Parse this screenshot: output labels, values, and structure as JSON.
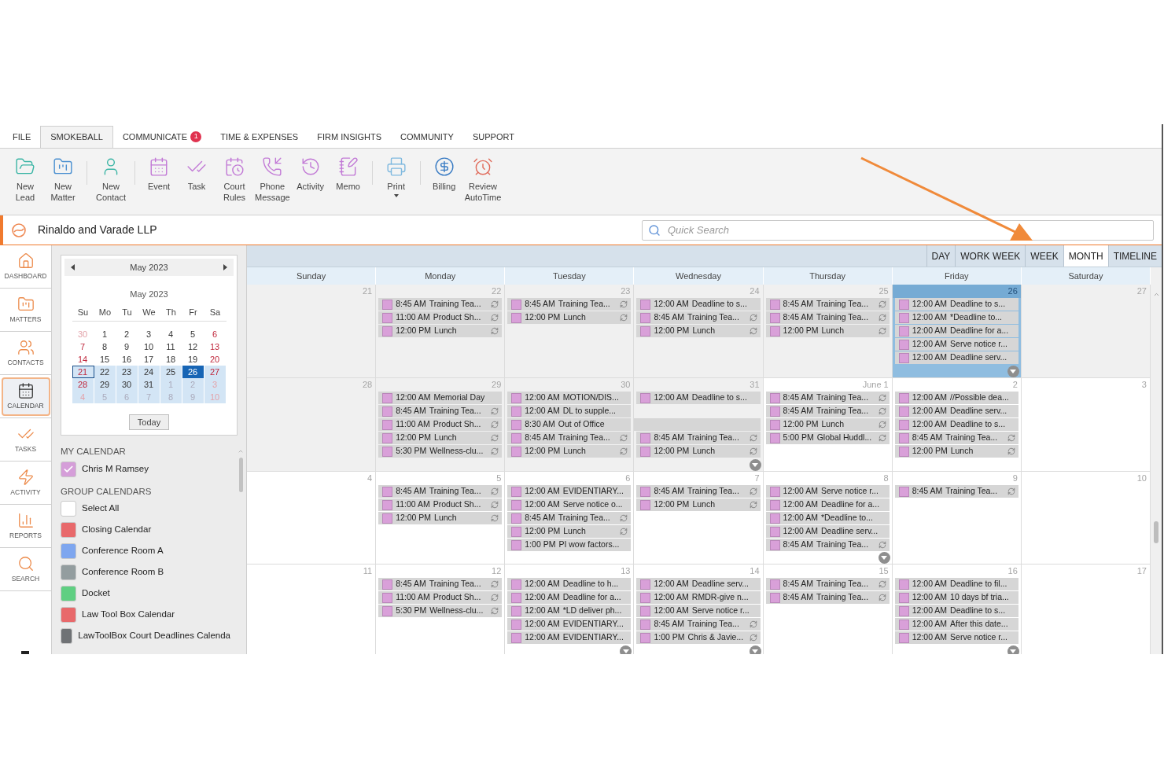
{
  "menu_tabs": [
    {
      "label": "FILE",
      "selected": false
    },
    {
      "label": "SMOKEBALL",
      "selected": true
    },
    {
      "label": "COMMUNICATE",
      "selected": false,
      "badge": "1"
    },
    {
      "label": "TIME & EXPENSES",
      "selected": false
    },
    {
      "label": "FIRM INSIGHTS",
      "selected": false
    },
    {
      "label": "COMMUNITY",
      "selected": false
    },
    {
      "label": "SUPPORT",
      "selected": false
    }
  ],
  "ribbon_groups": [
    [
      {
        "label": "New\nLead"
      },
      {
        "label": "New\nMatter"
      }
    ],
    [
      {
        "label": "New\nContact"
      }
    ],
    [
      {
        "label": "Event"
      },
      {
        "label": "Task"
      },
      {
        "label": "Court\nRules"
      },
      {
        "label": "Phone\nMessage"
      },
      {
        "label": "Activity"
      },
      {
        "label": "Memo"
      }
    ],
    [
      {
        "label": "Print",
        "dropdown": true
      }
    ],
    [
      {
        "label": "Billing"
      },
      {
        "label": "Review\nAutoTime"
      }
    ]
  ],
  "firm": {
    "name": "Rinaldo and Varade LLP"
  },
  "search": {
    "placeholder": "Quick Search"
  },
  "views": [
    {
      "label": "DAY",
      "selected": false
    },
    {
      "label": "WORK WEEK",
      "selected": false
    },
    {
      "label": "WEEK",
      "selected": false
    },
    {
      "label": "MONTH",
      "selected": true
    },
    {
      "label": "TIMELINE",
      "selected": false
    }
  ],
  "nav": [
    {
      "label": "DASHBOARD",
      "selected": false
    },
    {
      "label": "MATTERS",
      "selected": false
    },
    {
      "label": "CONTACTS",
      "selected": false
    },
    {
      "label": "CALENDAR",
      "selected": true
    },
    {
      "label": "TASKS",
      "selected": false
    },
    {
      "label": "ACTIVITY",
      "selected": false
    },
    {
      "label": "REPORTS",
      "selected": false
    },
    {
      "label": "SEARCH",
      "selected": false
    }
  ],
  "mini_calendar": {
    "header": "May 2023",
    "title": "May 2023",
    "weekdays": [
      "Su",
      "Mo",
      "Tu",
      "We",
      "Th",
      "Fr",
      "Sa"
    ],
    "today_button": "Today",
    "days": [
      {
        "label": "30",
        "other_month": true,
        "weekend": true,
        "in_range": false,
        "today": false,
        "selected": false
      },
      {
        "label": "1",
        "other_month": false,
        "weekend": false,
        "in_range": false,
        "today": false,
        "selected": false
      },
      {
        "label": "2",
        "other_month": false,
        "weekend": false,
        "in_range": false,
        "today": false,
        "selected": false
      },
      {
        "label": "3",
        "other_month": false,
        "weekend": false,
        "in_range": false,
        "today": false,
        "selected": false
      },
      {
        "label": "4",
        "other_month": false,
        "weekend": false,
        "in_range": false,
        "today": false,
        "selected": false
      },
      {
        "label": "5",
        "other_month": false,
        "weekend": false,
        "in_range": false,
        "today": false,
        "selected": false
      },
      {
        "label": "6",
        "other_month": false,
        "weekend": true,
        "in_range": false,
        "today": false,
        "selected": false
      },
      {
        "label": "7",
        "other_month": false,
        "weekend": true,
        "in_range": false,
        "today": false,
        "selected": false
      },
      {
        "label": "8",
        "other_month": false,
        "weekend": false,
        "in_range": false,
        "today": false,
        "selected": false
      },
      {
        "label": "9",
        "other_month": false,
        "weekend": false,
        "in_range": false,
        "today": false,
        "selected": false
      },
      {
        "label": "10",
        "other_month": false,
        "weekend": false,
        "in_range": false,
        "today": false,
        "selected": false
      },
      {
        "label": "11",
        "other_month": false,
        "weekend": false,
        "in_range": false,
        "today": false,
        "selected": false
      },
      {
        "label": "12",
        "other_month": false,
        "weekend": false,
        "in_range": false,
        "today": false,
        "selected": false
      },
      {
        "label": "13",
        "other_month": false,
        "weekend": true,
        "in_range": false,
        "today": false,
        "selected": false
      },
      {
        "label": "14",
        "other_month": false,
        "weekend": true,
        "in_range": false,
        "today": false,
        "selected": false
      },
      {
        "label": "15",
        "other_month": false,
        "weekend": false,
        "in_range": false,
        "today": false,
        "selected": false
      },
      {
        "label": "16",
        "other_month": false,
        "weekend": false,
        "in_range": false,
        "today": false,
        "selected": false
      },
      {
        "label": "17",
        "other_month": false,
        "weekend": false,
        "in_range": false,
        "today": false,
        "selected": false
      },
      {
        "label": "18",
        "other_month": false,
        "weekend": false,
        "in_range": false,
        "today": false,
        "selected": false
      },
      {
        "label": "19",
        "other_month": false,
        "weekend": false,
        "in_range": false,
        "today": false,
        "selected": false
      },
      {
        "label": "20",
        "other_month": false,
        "weekend": true,
        "in_range": false,
        "today": false,
        "selected": false
      },
      {
        "label": "21",
        "other_month": false,
        "weekend": true,
        "in_range": true,
        "today": true,
        "selected": false
      },
      {
        "label": "22",
        "other_month": false,
        "weekend": false,
        "in_range": true,
        "today": false,
        "selected": false
      },
      {
        "label": "23",
        "other_month": false,
        "weekend": false,
        "in_range": true,
        "today": false,
        "selected": false
      },
      {
        "label": "24",
        "other_month": false,
        "weekend": false,
        "in_range": true,
        "today": false,
        "selected": false
      },
      {
        "label": "25",
        "other_month": false,
        "weekend": false,
        "in_range": true,
        "today": false,
        "selected": false
      },
      {
        "label": "26",
        "other_month": false,
        "weekend": false,
        "in_range": true,
        "today": false,
        "selected": true
      },
      {
        "label": "27",
        "other_month": false,
        "weekend": true,
        "in_range": true,
        "today": false,
        "selected": false
      },
      {
        "label": "28",
        "other_month": false,
        "weekend": true,
        "in_range": true,
        "today": false,
        "selected": false
      },
      {
        "label": "29",
        "other_month": false,
        "weekend": false,
        "in_range": true,
        "today": false,
        "selected": false
      },
      {
        "label": "30",
        "other_month": false,
        "weekend": false,
        "in_range": true,
        "today": false,
        "selected": false
      },
      {
        "label": "31",
        "other_month": false,
        "weekend": false,
        "in_range": true,
        "today": false,
        "selected": false
      },
      {
        "label": "1",
        "other_month": true,
        "weekend": false,
        "in_range": true,
        "today": false,
        "selected": false
      },
      {
        "label": "2",
        "other_month": true,
        "weekend": false,
        "in_range": true,
        "today": false,
        "selected": false
      },
      {
        "label": "3",
        "other_month": true,
        "weekend": true,
        "in_range": true,
        "today": false,
        "selected": false
      },
      {
        "label": "4",
        "other_month": true,
        "weekend": true,
        "in_range": true,
        "today": false,
        "selected": false
      },
      {
        "label": "5",
        "other_month": true,
        "weekend": false,
        "in_range": true,
        "today": false,
        "selected": false
      },
      {
        "label": "6",
        "other_month": true,
        "weekend": false,
        "in_range": true,
        "today": false,
        "selected": false
      },
      {
        "label": "7",
        "other_month": true,
        "weekend": false,
        "in_range": true,
        "today": false,
        "selected": false
      },
      {
        "label": "8",
        "other_month": true,
        "weekend": false,
        "in_range": true,
        "today": false,
        "selected": false
      },
      {
        "label": "9",
        "other_month": true,
        "weekend": false,
        "in_range": true,
        "today": false,
        "selected": false
      },
      {
        "label": "10",
        "other_month": true,
        "weekend": true,
        "in_range": true,
        "today": false,
        "selected": false
      }
    ]
  },
  "my_calendar": {
    "heading": "MY CALENDAR",
    "items": [
      {
        "label": "Chris M Ramsey",
        "checked": true,
        "color": "#d59ed9"
      }
    ]
  },
  "group_calendars": {
    "heading": "GROUP CALENDARS",
    "items": [
      {
        "label": "Select All",
        "checked": false
      },
      {
        "label": "Closing Calendar",
        "checked": false,
        "color": "#e8696b"
      },
      {
        "label": "Conference Room A",
        "checked": false,
        "color": "#7ea6ef"
      },
      {
        "label": "Conference Room B",
        "checked": false,
        "color": "#939d9f"
      },
      {
        "label": "Docket",
        "checked": false,
        "color": "#5fcf82"
      },
      {
        "label": "Law Tool Box Calendar",
        "checked": false,
        "color": "#e8696b"
      },
      {
        "label": "LawToolBox Court Deadlines Calenda",
        "checked": false,
        "color": "#6f7275"
      }
    ]
  },
  "calendar": {
    "weekdays": [
      "Sunday",
      "Monday",
      "Tuesday",
      "Wednesday",
      "Thursday",
      "Friday",
      "Saturday"
    ],
    "weeks": [
      {
        "days": [
          {
            "label": "21",
            "in_month": true,
            "selected": false,
            "more": false
          },
          {
            "label": "22",
            "in_month": true,
            "selected": false,
            "more": false,
            "events": [
              {
                "kind": "event",
                "time": "8:45 AM",
                "title": "Training Tea...",
                "recurring": true
              },
              {
                "kind": "event",
                "time": "11:00 AM",
                "title": "Product Sh...",
                "recurring": true
              },
              {
                "kind": "event",
                "time": "12:00 PM",
                "title": "Lunch",
                "recurring": true
              }
            ]
          },
          {
            "label": "23",
            "in_month": true,
            "selected": false,
            "more": false,
            "events": [
              {
                "kind": "event",
                "time": "8:45 AM",
                "title": "Training Tea...",
                "recurring": true
              },
              {
                "kind": "event",
                "time": "12:00 PM",
                "title": "Lunch",
                "recurring": true
              }
            ]
          },
          {
            "label": "24",
            "in_month": true,
            "selected": false,
            "more": false,
            "events": [
              {
                "kind": "event",
                "time": "12:00 AM",
                "title": "Deadline to s...",
                "recurring": false
              },
              {
                "kind": "event",
                "time": "8:45 AM",
                "title": "Training Tea...",
                "recurring": true
              },
              {
                "kind": "event",
                "time": "12:00 PM",
                "title": "Lunch",
                "recurring": true
              }
            ]
          },
          {
            "label": "25",
            "in_month": true,
            "selected": false,
            "more": false,
            "events": [
              {
                "kind": "event",
                "time": "8:45 AM",
                "title": "Training Tea...",
                "recurring": true
              },
              {
                "kind": "event",
                "time": "8:45 AM",
                "title": "Training Tea...",
                "recurring": true
              },
              {
                "kind": "event",
                "time": "12:00 PM",
                "title": "Lunch",
                "recurring": true
              }
            ]
          },
          {
            "label": "26",
            "in_month": true,
            "selected": true,
            "more": true,
            "events": [
              {
                "kind": "event",
                "time": "12:00 AM",
                "title": "Deadline to s...",
                "recurring": false
              },
              {
                "kind": "event",
                "time": "12:00 AM",
                "title": "*Deadline to...",
                "recurring": false
              },
              {
                "kind": "event",
                "time": "12:00 AM",
                "title": "Deadline for a...",
                "recurring": false
              },
              {
                "kind": "event",
                "time": "12:00 AM",
                "title": "Serve notice r...",
                "recurring": false
              },
              {
                "kind": "event",
                "time": "12:00 AM",
                "title": "Deadline serv...",
                "recurring": false
              }
            ]
          },
          {
            "label": "27",
            "in_month": true,
            "selected": false,
            "more": false
          }
        ]
      },
      {
        "days": [
          {
            "label": "28",
            "in_month": true,
            "selected": false,
            "more": false
          },
          {
            "label": "29",
            "in_month": true,
            "selected": false,
            "more": false,
            "events": [
              {
                "kind": "event",
                "time": "12:00 AM",
                "title": "Memorial Day",
                "recurring": false
              },
              {
                "kind": "event",
                "time": "8:45 AM",
                "title": "Training Tea...",
                "recurring": true
              },
              {
                "kind": "event",
                "time": "11:00 AM",
                "title": "Product Sh...",
                "recurring": true
              },
              {
                "kind": "event",
                "time": "12:00 PM",
                "title": "Lunch",
                "recurring": true
              },
              {
                "kind": "event",
                "time": "5:30 PM",
                "title": "Wellness-clu...",
                "recurring": true
              }
            ]
          },
          {
            "label": "30",
            "in_month": true,
            "selected": false,
            "more": false,
            "events": [
              {
                "kind": "event",
                "time": "12:00 AM",
                "title": "MOTION/DIS...",
                "recurring": false
              },
              {
                "kind": "event",
                "time": "12:00 AM",
                "title": "DL to supple...",
                "recurring": false
              },
              {
                "kind": "event",
                "time": "8:30 AM",
                "title": "Out of Office",
                "recurring": false
              },
              {
                "kind": "event",
                "time": "8:45 AM",
                "title": "Training Tea...",
                "recurring": true
              },
              {
                "kind": "event",
                "time": "12:00 PM",
                "title": "Lunch",
                "recurring": true
              }
            ]
          },
          {
            "label": "31",
            "in_month": true,
            "selected": false,
            "more": true,
            "events": [
              {
                "kind": "event",
                "time": "12:00 AM",
                "title": "Deadline to s...",
                "recurring": false
              },
              {
                "kind": "spacer"
              },
              {
                "kind": "continued"
              },
              {
                "kind": "event",
                "time": "8:45 AM",
                "title": "Training Tea...",
                "recurring": true
              },
              {
                "kind": "event",
                "time": "12:00 PM",
                "title": "Lunch",
                "recurring": true
              }
            ]
          },
          {
            "label": "June 1",
            "in_month": false,
            "selected": false,
            "more": false,
            "events": [
              {
                "kind": "event",
                "time": "8:45 AM",
                "title": "Training Tea...",
                "recurring": true
              },
              {
                "kind": "event",
                "time": "8:45 AM",
                "title": "Training Tea...",
                "recurring": true
              },
              {
                "kind": "event",
                "time": "12:00 PM",
                "title": "Lunch",
                "recurring": true
              },
              {
                "kind": "event",
                "time": "5:00 PM",
                "title": "Global Huddl...",
                "recurring": true
              }
            ]
          },
          {
            "label": "2",
            "in_month": false,
            "selected": false,
            "more": false,
            "events": [
              {
                "kind": "event",
                "time": "12:00 AM",
                "title": "//Possible dea...",
                "recurring": false
              },
              {
                "kind": "event",
                "time": "12:00 AM",
                "title": "Deadline serv...",
                "recurring": false
              },
              {
                "kind": "event",
                "time": "12:00 AM",
                "title": "Deadline to s...",
                "recurring": false
              },
              {
                "kind": "event",
                "time": "8:45 AM",
                "title": "Training Tea...",
                "recurring": true
              },
              {
                "kind": "event",
                "time": "12:00 PM",
                "title": "Lunch",
                "recurring": true
              }
            ]
          },
          {
            "label": "3",
            "in_month": false,
            "selected": false,
            "more": false
          }
        ]
      },
      {
        "days": [
          {
            "label": "4",
            "in_month": false,
            "selected": false,
            "more": false
          },
          {
            "label": "5",
            "in_month": false,
            "selected": false,
            "more": false,
            "events": [
              {
                "kind": "event",
                "time": "8:45 AM",
                "title": "Training Tea...",
                "recurring": true
              },
              {
                "kind": "event",
                "time": "11:00 AM",
                "title": "Product Sh...",
                "recurring": true
              },
              {
                "kind": "event",
                "time": "12:00 PM",
                "title": "Lunch",
                "recurring": true
              }
            ]
          },
          {
            "label": "6",
            "in_month": false,
            "selected": false,
            "more": false,
            "events": [
              {
                "kind": "event",
                "time": "12:00 AM",
                "title": "EVIDENTIARY...",
                "recurring": false
              },
              {
                "kind": "event",
                "time": "12:00 AM",
                "title": "Serve notice o...",
                "recurring": false
              },
              {
                "kind": "event",
                "time": "8:45 AM",
                "title": "Training Tea...",
                "recurring": true
              },
              {
                "kind": "event",
                "time": "12:00 PM",
                "title": "Lunch",
                "recurring": true
              },
              {
                "kind": "event",
                "time": "1:00 PM",
                "title": "PI wow factors...",
                "recurring": false
              }
            ]
          },
          {
            "label": "7",
            "in_month": false,
            "selected": false,
            "more": false,
            "events": [
              {
                "kind": "event",
                "time": "8:45 AM",
                "title": "Training Tea...",
                "recurring": true
              },
              {
                "kind": "event",
                "time": "12:00 PM",
                "title": "Lunch",
                "recurring": true
              }
            ]
          },
          {
            "label": "8",
            "in_month": false,
            "selected": false,
            "more": true,
            "events": [
              {
                "kind": "event",
                "time": "12:00 AM",
                "title": "Serve notice r...",
                "recurring": false
              },
              {
                "kind": "event",
                "time": "12:00 AM",
                "title": "Deadline for a...",
                "recurring": false
              },
              {
                "kind": "event",
                "time": "12:00 AM",
                "title": "*Deadline to...",
                "recurring": false
              },
              {
                "kind": "event",
                "time": "12:00 AM",
                "title": "Deadline serv...",
                "recurring": false
              },
              {
                "kind": "event",
                "time": "8:45 AM",
                "title": "Training Tea...",
                "recurring": true
              }
            ]
          },
          {
            "label": "9",
            "in_month": false,
            "selected": false,
            "more": false,
            "events": [
              {
                "kind": "event",
                "time": "8:45 AM",
                "title": "Training Tea...",
                "recurring": true
              }
            ]
          },
          {
            "label": "10",
            "in_month": false,
            "selected": false,
            "more": false
          }
        ]
      },
      {
        "days": [
          {
            "label": "11",
            "in_month": false,
            "selected": false,
            "more": false
          },
          {
            "label": "12",
            "in_month": false,
            "selected": false,
            "more": false,
            "events": [
              {
                "kind": "event",
                "time": "8:45 AM",
                "title": "Training Tea...",
                "recurring": true
              },
              {
                "kind": "event",
                "time": "11:00 AM",
                "title": "Product Sh...",
                "recurring": true
              },
              {
                "kind": "event",
                "time": "5:30 PM",
                "title": "Wellness-clu...",
                "recurring": true
              }
            ]
          },
          {
            "label": "13",
            "in_month": false,
            "selected": false,
            "more": true,
            "events": [
              {
                "kind": "event",
                "time": "12:00 AM",
                "title": "Deadline to h...",
                "recurring": false
              },
              {
                "kind": "event",
                "time": "12:00 AM",
                "title": "Deadline for a...",
                "recurring": false
              },
              {
                "kind": "event",
                "time": "12:00 AM",
                "title": "*LD deliver ph...",
                "recurring": false
              },
              {
                "kind": "event",
                "time": "12:00 AM",
                "title": "EVIDENTIARY...",
                "recurring": false
              },
              {
                "kind": "event",
                "time": "12:00 AM",
                "title": "EVIDENTIARY...",
                "recurring": false
              }
            ]
          },
          {
            "label": "14",
            "in_month": false,
            "selected": false,
            "more": true,
            "events": [
              {
                "kind": "event",
                "time": "12:00 AM",
                "title": "Deadline serv...",
                "recurring": false
              },
              {
                "kind": "event",
                "time": "12:00 AM",
                "title": "RMDR-give n...",
                "recurring": false
              },
              {
                "kind": "event",
                "time": "12:00 AM",
                "title": "Serve notice r...",
                "recurring": false
              },
              {
                "kind": "event",
                "time": "8:45 AM",
                "title": "Training Tea...",
                "recurring": true
              },
              {
                "kind": "event",
                "time": "1:00 PM",
                "title": "Chris & Javie...",
                "recurring": true
              }
            ]
          },
          {
            "label": "15",
            "in_month": false,
            "selected": false,
            "more": false,
            "events": [
              {
                "kind": "event",
                "time": "8:45 AM",
                "title": "Training Tea...",
                "recurring": true
              },
              {
                "kind": "event",
                "time": "8:45 AM",
                "title": "Training Tea...",
                "recurring": true
              }
            ]
          },
          {
            "label": "16",
            "in_month": false,
            "selected": false,
            "more": true,
            "events": [
              {
                "kind": "event",
                "time": "12:00 AM",
                "title": "Deadline to fil...",
                "recurring": false
              },
              {
                "kind": "event",
                "time": "12:00 AM",
                "title": "10 days bf tria...",
                "recurring": false
              },
              {
                "kind": "event",
                "time": "12:00 AM",
                "title": "Deadline to s...",
                "recurring": false
              },
              {
                "kind": "event",
                "time": "12:00 AM",
                "title": "After this date...",
                "recurring": false
              },
              {
                "kind": "event",
                "time": "12:00 AM",
                "title": "Serve notice r...",
                "recurring": false
              }
            ]
          },
          {
            "label": "17",
            "in_month": false,
            "selected": false,
            "more": false
          }
        ]
      }
    ]
  }
}
